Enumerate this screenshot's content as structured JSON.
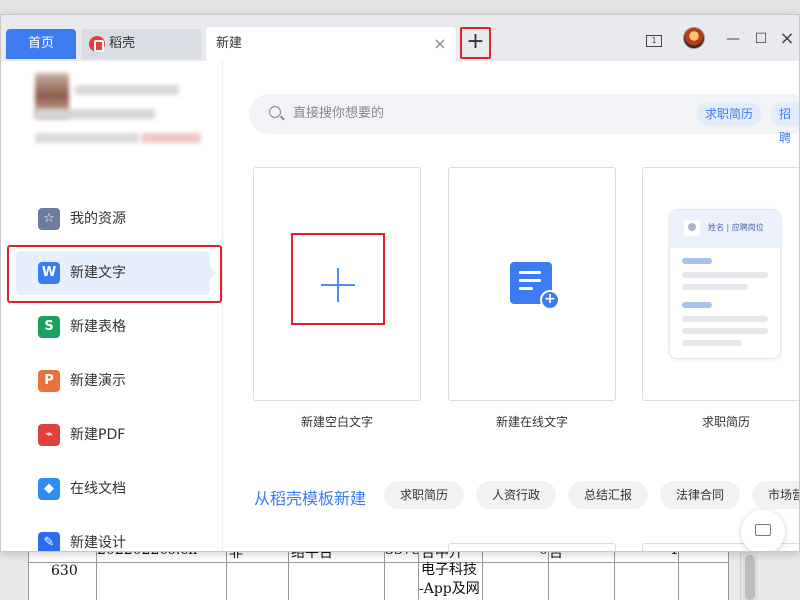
{
  "background_doc": {
    "date_fragment": "20220220",
    "domain_fragment": "6.cn",
    "type_fragment": "非",
    "platform_fragment": "络平台",
    "number_fragment": "3373",
    "company_fragment": "合中升",
    "row_number": "630",
    "company_line2": "电子科技",
    "company_line3": "-App及网",
    "zero_value": "0",
    "bool_fragment": "否",
    "one_value": "1"
  },
  "tabs": {
    "home": "首页",
    "daoke": "稻壳",
    "new": "新建",
    "close_glyph": "×",
    "add_glyph": "+"
  },
  "window_controls": {
    "window_badge": "1",
    "minimize": "—",
    "maximize": "☐",
    "close": "×"
  },
  "sidebar": {
    "items": [
      {
        "label": "我的资源",
        "icon": "star-icon",
        "color": "#6b7c9e"
      },
      {
        "label": "新建文字",
        "icon": "word-icon",
        "color": "#3d7cf0",
        "active": true
      },
      {
        "label": "新建表格",
        "icon": "sheet-icon",
        "color": "#1aa260"
      },
      {
        "label": "新建演示",
        "icon": "slides-icon",
        "color": "#e8713c"
      },
      {
        "label": "新建PDF",
        "icon": "pdf-icon",
        "color": "#e2403a"
      },
      {
        "label": "在线文档",
        "icon": "cloud-doc-icon",
        "color": "#2d8ef0"
      },
      {
        "label": "新建设计",
        "icon": "design-icon",
        "color": "#2d6cf0"
      }
    ],
    "icon_glyphs": {
      "star": "☆",
      "word": "W",
      "sheet": "S",
      "slides": "P",
      "pdf": "⌁",
      "cloud": "◆",
      "design": "✎"
    }
  },
  "search": {
    "placeholder": "直接搜你想要的",
    "chips": [
      "求职简历",
      "招聘"
    ]
  },
  "cards": [
    {
      "label": "新建空白文字"
    },
    {
      "label": "新建在线文字"
    },
    {
      "label": "求职简历"
    }
  ],
  "resume_preview": {
    "header_text": "姓名 | 应聘岗位"
  },
  "templates": {
    "title": "从稻壳模板新建",
    "chips": [
      "求职简历",
      "人资行政",
      "总结汇报",
      "法律合同",
      "市场营"
    ]
  },
  "colors": {
    "accent": "#3d7cf0",
    "highlight_frame": "#e0232b"
  }
}
